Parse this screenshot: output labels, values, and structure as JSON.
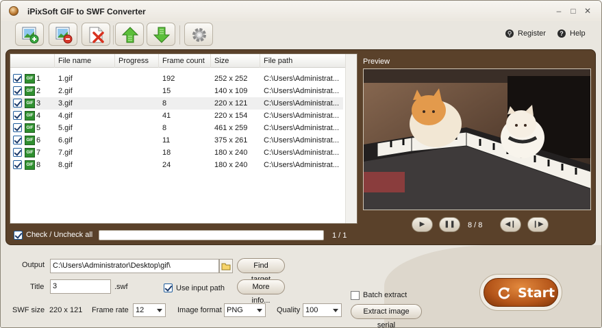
{
  "window": {
    "title": "iPixSoft GIF to SWF Converter"
  },
  "toolbar": {
    "buttons": [
      {
        "name": "add-file-button",
        "icon": "add-image-icon"
      },
      {
        "name": "remove-file-button",
        "icon": "remove-image-icon"
      },
      {
        "name": "clear-list-button",
        "icon": "delete-icon"
      },
      {
        "name": "move-up-button",
        "icon": "arrow-up-icon"
      },
      {
        "name": "move-down-button",
        "icon": "arrow-down-icon"
      },
      {
        "name": "settings-button",
        "icon": "gear-icon"
      }
    ],
    "register_label": "Register",
    "help_label": "Help"
  },
  "file_list": {
    "columns": [
      "File name",
      "Progress",
      "Frame count",
      "Size",
      "File path"
    ],
    "rows": [
      {
        "index": "1",
        "file_name": "1.gif",
        "progress": "",
        "frame_count": "192",
        "size": "252 x 252",
        "file_path": "C:\\Users\\Administrat...",
        "checked": true
      },
      {
        "index": "2",
        "file_name": "2.gif",
        "progress": "",
        "frame_count": "15",
        "size": "140 x 109",
        "file_path": "C:\\Users\\Administrat...",
        "checked": true
      },
      {
        "index": "3",
        "file_name": "3.gif",
        "progress": "",
        "frame_count": "8",
        "size": "220 x 121",
        "file_path": "C:\\Users\\Administrat...",
        "checked": true
      },
      {
        "index": "4",
        "file_name": "4.gif",
        "progress": "",
        "frame_count": "41",
        "size": "220 x 154",
        "file_path": "C:\\Users\\Administrat...",
        "checked": true
      },
      {
        "index": "5",
        "file_name": "5.gif",
        "progress": "",
        "frame_count": "8",
        "size": "461 x 259",
        "file_path": "C:\\Users\\Administrat...",
        "checked": true
      },
      {
        "index": "6",
        "file_name": "6.gif",
        "progress": "",
        "frame_count": "11",
        "size": "375 x 261",
        "file_path": "C:\\Users\\Administrat...",
        "checked": true
      },
      {
        "index": "7",
        "file_name": "7.gif",
        "progress": "",
        "frame_count": "18",
        "size": "180 x 240",
        "file_path": "C:\\Users\\Administrat...",
        "checked": true
      },
      {
        "index": "8",
        "file_name": "8.gif",
        "progress": "",
        "frame_count": "24",
        "size": "180 x 240",
        "file_path": "C:\\Users\\Administrat...",
        "checked": true
      }
    ],
    "selected_index": 2,
    "gif_badge": "GIF",
    "check_all_label": "Check / Uncheck all",
    "count_text": "1 / 1"
  },
  "preview": {
    "label": "Preview",
    "frame_counter": "8 / 8"
  },
  "output": {
    "output_label": "Output",
    "output_path": "C:\\Users\\Administrator\\Desktop\\gif\\",
    "find_target_label": "Find target",
    "title_label": "Title",
    "title_value": "3",
    "swf_ext": ".swf",
    "use_input_path_label": "Use input path",
    "more_info_label": "More info...",
    "swf_size_label": "SWF size",
    "swf_size_value": "220 x 121",
    "frame_rate_label": "Frame rate",
    "frame_rate_value": "12",
    "image_format_label": "Image format",
    "image_format_value": "PNG",
    "quality_label": "Quality",
    "quality_value": "100",
    "batch_extract_label": "Batch extract",
    "extract_serial_label": "Extract image serial",
    "start_label": "Start"
  },
  "colors": {
    "panel_brown": "#5a412a",
    "start_orange": "#c4641f",
    "window_bg": "#e9e6df"
  }
}
